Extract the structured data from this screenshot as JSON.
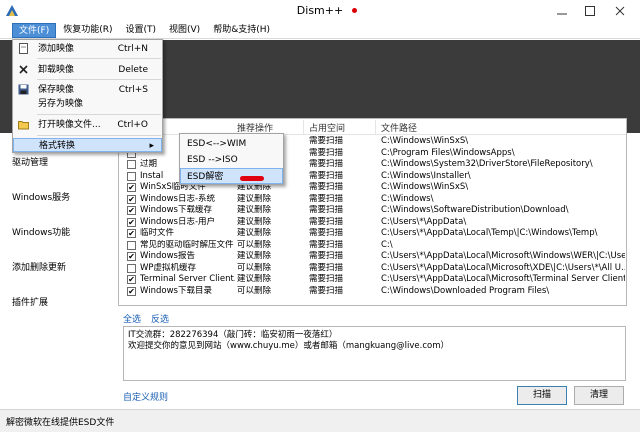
{
  "app": {
    "title": "Dism++"
  },
  "menubar": {
    "items": [
      "文件(F)",
      "恢复功能(R)",
      "设置(T)",
      "视图(V)",
      "帮助&支持(H)"
    ]
  },
  "file_menu": {
    "items": [
      {
        "label": "添加映像",
        "shortcut": "Ctrl+N",
        "icon": "add-image-icon"
      },
      {
        "label": "卸载映像",
        "shortcut": "Delete",
        "icon": "close-x-icon"
      },
      {
        "label": "保存映像",
        "shortcut": "Ctrl+S",
        "icon": "save-disk-icon"
      },
      {
        "label": "另存为映像",
        "shortcut": "",
        "icon": ""
      },
      {
        "label": "打开映像文件...",
        "shortcut": "Ctrl+O",
        "icon": "open-folder-icon"
      },
      {
        "label": "格式转换",
        "shortcut": "",
        "icon": "",
        "submenu_arrow": "▸"
      }
    ]
  },
  "format_submenu": {
    "items": [
      "ESD<-->WIM",
      "ESD -->ISO",
      "ESD解密"
    ]
  },
  "sidebar": {
    "items": [
      "驱动管理",
      "Windows服务",
      "Windows功能",
      "添加删除更新",
      "插件扩展"
    ]
  },
  "table": {
    "columns": [
      "推荐操作",
      "占用空间",
      "文件路径"
    ],
    "rows": [
      {
        "name": "",
        "checked": false,
        "action": "",
        "size": "需要扫描",
        "path": "C:\\Windows\\WinSxS\\"
      },
      {
        "name": "",
        "checked": false,
        "action": "",
        "size": "需要扫描",
        "path": "C:\\Program Files\\WindowsApps\\"
      },
      {
        "name": "过期",
        "checked": false,
        "action": "",
        "size": "需要扫描",
        "path": "C:\\Windows\\System32\\DriverStore\\FileRepository\\"
      },
      {
        "name": "Instal",
        "checked": false,
        "action": "",
        "size": "需要扫描",
        "path": "C:\\Windows\\Installer\\"
      },
      {
        "name": "WinSxS临时文件",
        "checked": true,
        "action": "建议删除",
        "size": "需要扫描",
        "path": "C:\\Windows\\WinSxS\\"
      },
      {
        "name": "Windows日志-系统",
        "checked": true,
        "action": "建议删除",
        "size": "需要扫描",
        "path": "C:\\Windows\\"
      },
      {
        "name": "Windows下载缓存",
        "checked": true,
        "action": "建议删除",
        "size": "需要扫描",
        "path": "C:\\Windows\\SoftwareDistribution\\Download\\"
      },
      {
        "name": "Windows日志-用户",
        "checked": true,
        "action": "建议删除",
        "size": "需要扫描",
        "path": "C:\\Users\\*\\AppData\\"
      },
      {
        "name": "临时文件",
        "checked": true,
        "action": "建议删除",
        "size": "需要扫描",
        "path": "C:\\Users\\*\\AppData\\Local\\Temp\\|C:\\Windows\\Temp\\"
      },
      {
        "name": "常见的驱动临时解压文件",
        "checked": false,
        "action": "可以删除",
        "size": "需要扫描",
        "path": "C:\\"
      },
      {
        "name": "Windows报告",
        "checked": true,
        "action": "建议删除",
        "size": "需要扫描",
        "path": "C:\\Users\\*\\AppData\\Local\\Microsoft\\Windows\\WER\\|C:\\Users\\*\\..."
      },
      {
        "name": "WP虚拟机缓存",
        "checked": false,
        "action": "可以删除",
        "size": "需要扫描",
        "path": "C:\\Users\\*\\AppData\\Local\\Microsoft\\XDE\\|C:\\Users\\*\\All U..."
      },
      {
        "name": "Terminal Server Client...",
        "checked": true,
        "action": "建议删除",
        "size": "需要扫描",
        "path": "C:\\Users\\*\\AppData\\Local\\Microsoft\\Terminal Server Client\\..."
      },
      {
        "name": "Windows下载目录",
        "checked": true,
        "action": "可以删除",
        "size": "需要扫描",
        "path": "C:\\Windows\\Downloaded Program Files\\"
      }
    ]
  },
  "links": {
    "select_all": "全选",
    "invert": "反选",
    "custom_rules": "自定义规则"
  },
  "info_text": {
    "line1": "IT交流群：282276394（敲门砖：临安初雨一夜落红）",
    "line2": "欢迎提交你的意见到网站（www.chuyu.me）或者邮箱（mangkuang@live.com）"
  },
  "buttons": {
    "scan": "扫描",
    "clean": "清理"
  },
  "status": {
    "text": "解密微软在线提供ESD文件"
  },
  "colors": {
    "accent": "#4d8fd6",
    "dark_band": "#3b3b3b",
    "red_mark": "#e10010",
    "link": "#1a5fb4"
  }
}
